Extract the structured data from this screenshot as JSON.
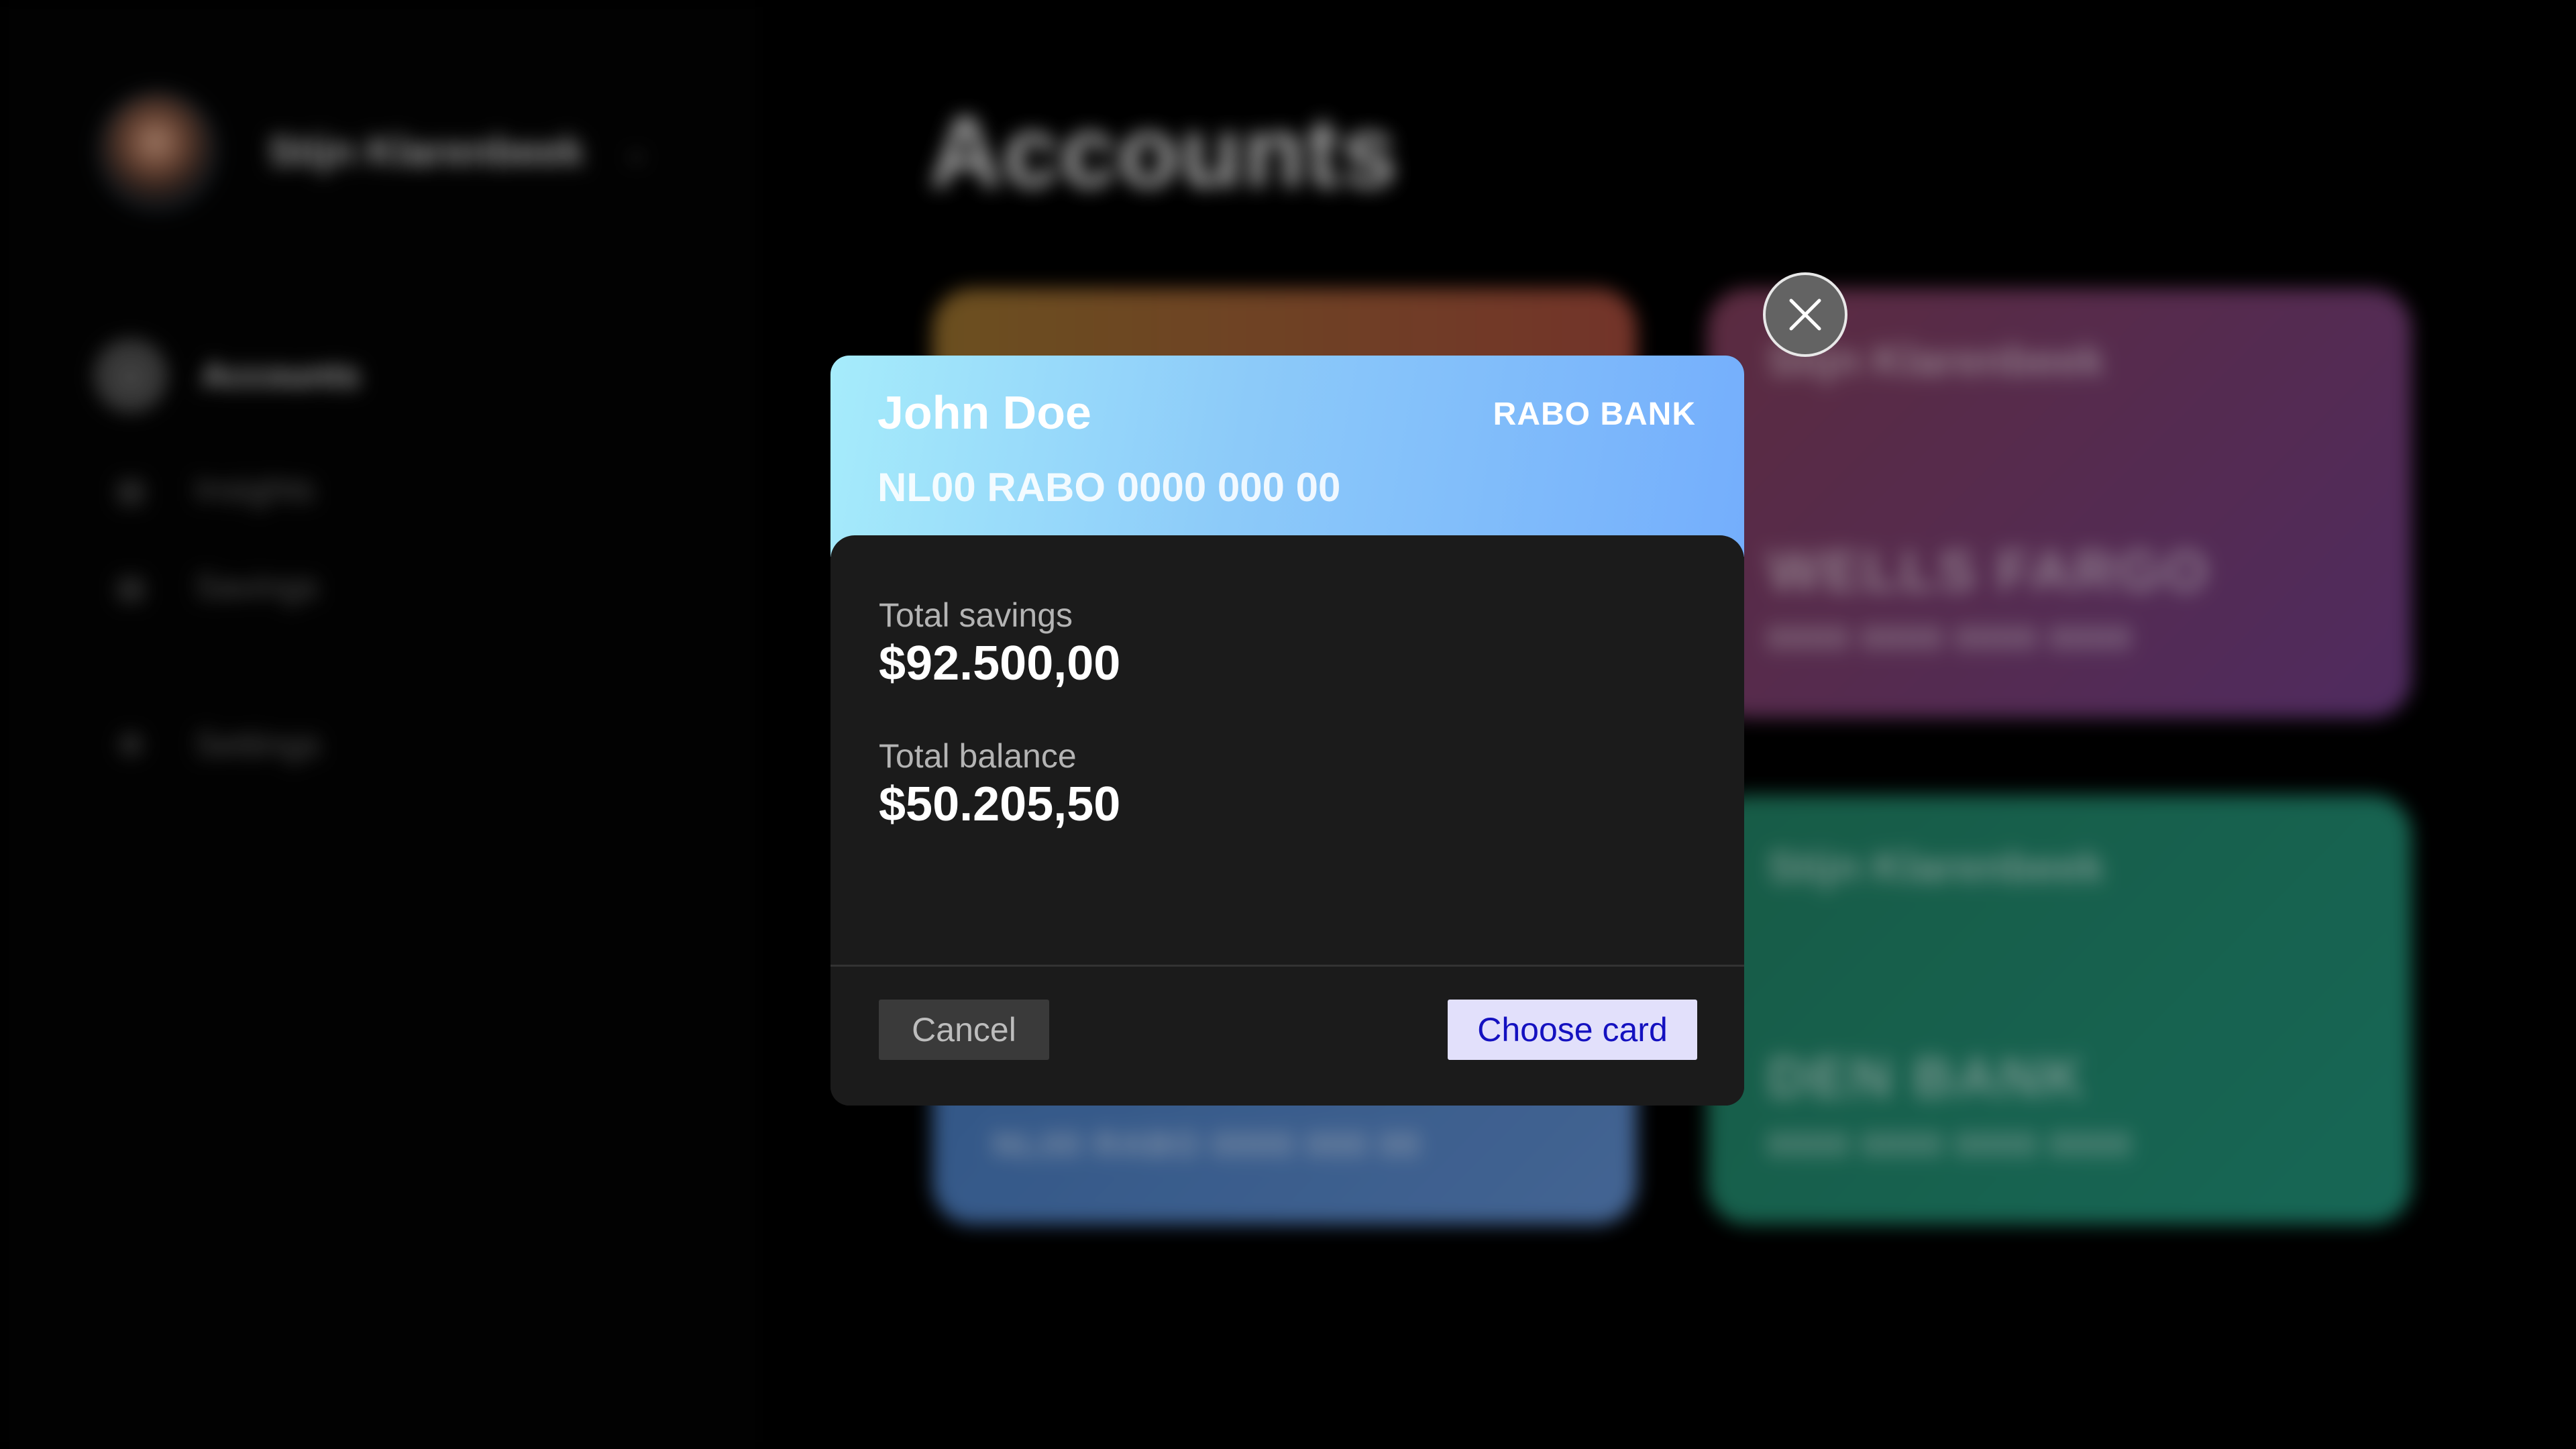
{
  "background": {
    "user": {
      "name": "Stijn Klarenbeek"
    },
    "nav": [
      {
        "label": "Accounts",
        "icon": "accounts-icon",
        "active": true
      },
      {
        "label": "Insights",
        "icon": "insights-icon",
        "active": false
      },
      {
        "label": "Savings",
        "icon": "savings-icon",
        "active": false
      },
      {
        "label": "Settings",
        "icon": "settings-icon",
        "active": false
      }
    ],
    "page_title": "Accounts",
    "cards": [
      {
        "holder": "",
        "bank": "",
        "number": ""
      },
      {
        "holder": "Stijn Klarenbeek",
        "bank": "WELLS FARGO",
        "number": "0000 0000 0000 0000"
      },
      {
        "holder": "",
        "bank": "",
        "number": "NL00 RABO 0000 000 00"
      },
      {
        "holder": "Stijn Klarenbeek",
        "bank": "DEN BANK",
        "number": "0000 0000 0000 0000"
      }
    ]
  },
  "modal": {
    "card": {
      "holder": "John Doe",
      "bank": "RABO BANK",
      "iban": "NL00 RABO 0000 000 00"
    },
    "stats": {
      "savings_label": "Total savings",
      "savings_value": "$92.500,00",
      "balance_label": "Total balance",
      "balance_value": "$50.205,50"
    },
    "buttons": {
      "cancel": "Cancel",
      "choose": "Choose card"
    },
    "close_icon": "close-icon"
  },
  "colors": {
    "card_gradient_start": "#a6ecfb",
    "card_gradient_end": "#74aefc",
    "modal_bg": "#1b1b1b",
    "primary_button_bg": "#e2e0fb",
    "primary_button_text": "#1411c0"
  }
}
